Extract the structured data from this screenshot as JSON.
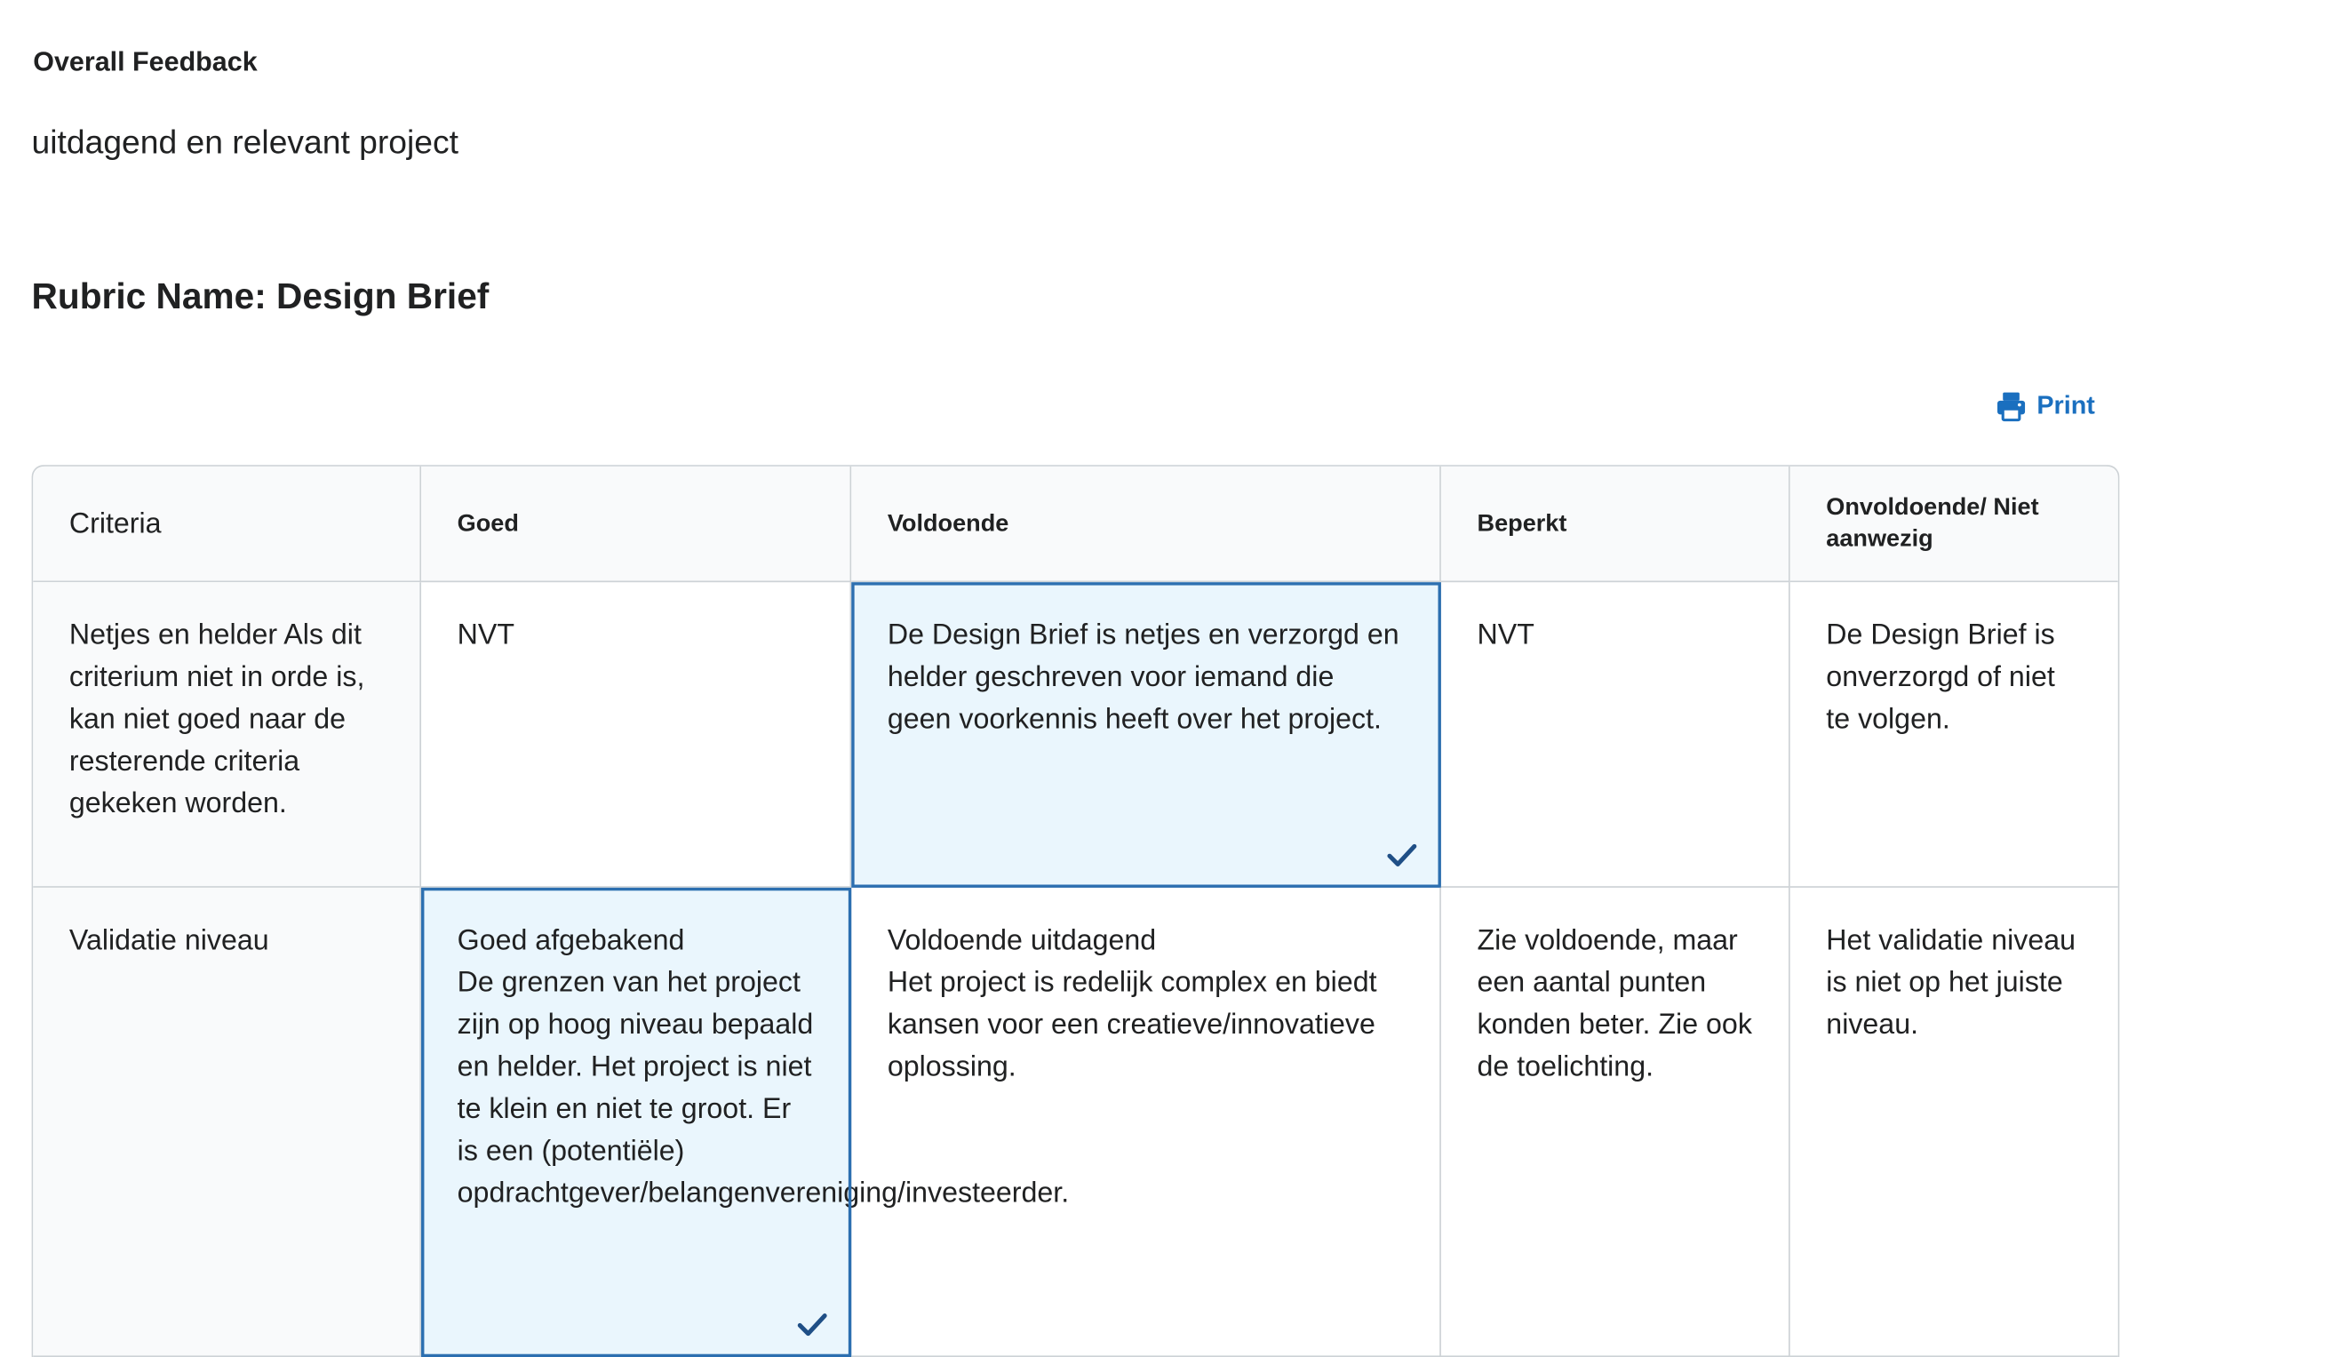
{
  "overall_feedback": {
    "label": "Overall Feedback",
    "text": "uitdagend en relevant project"
  },
  "rubric": {
    "title": "Rubric Name: Design Brief",
    "print_label": "Print",
    "headers": [
      "Criteria",
      "Goed",
      "Voldoende",
      "Beperkt",
      "Onvoldoende/ Niet aanwezig"
    ],
    "rows": [
      {
        "criterion": "Netjes en helder Als dit criterium niet in orde is, kan niet goed naar de resterende criteria gekeken worden.",
        "cells": [
          "NVT",
          "De Design Brief is netjes en verzorgd en helder geschreven voor iemand die geen voorkennis heeft over het project.",
          "NVT",
          "De Design Brief is onverzorgd of niet te volgen."
        ],
        "selected_level": "Voldoende"
      },
      {
        "criterion": "Validatie niveau",
        "cells": [
          {
            "title": "Goed afgebakend",
            "body": "De grenzen van het project zijn op hoog niveau bepaald en helder. Het project is niet te klein en niet te groot. Er is een (potentiële) opdrachtgever/belangenvereniging/investeerder."
          },
          {
            "title": "Voldoende uitdagend",
            "body": "Het project is redelijk complex en biedt kansen voor een creatieve/innovatieve oplossing."
          },
          "Zie voldoende, maar een aantal punten konden beter. Zie ook de toelichting.",
          "Het validatie niveau is niet op het juiste niveau."
        ],
        "selected_level": "Goed"
      }
    ]
  },
  "icons": {
    "print": "printer-icon",
    "selected": "checkmark-icon"
  },
  "colors": {
    "accent": "#1a6fbf",
    "selected_bg": "#eaf6fd",
    "selected_border": "#2c6fb0",
    "selected_text": "#1f4f86"
  }
}
